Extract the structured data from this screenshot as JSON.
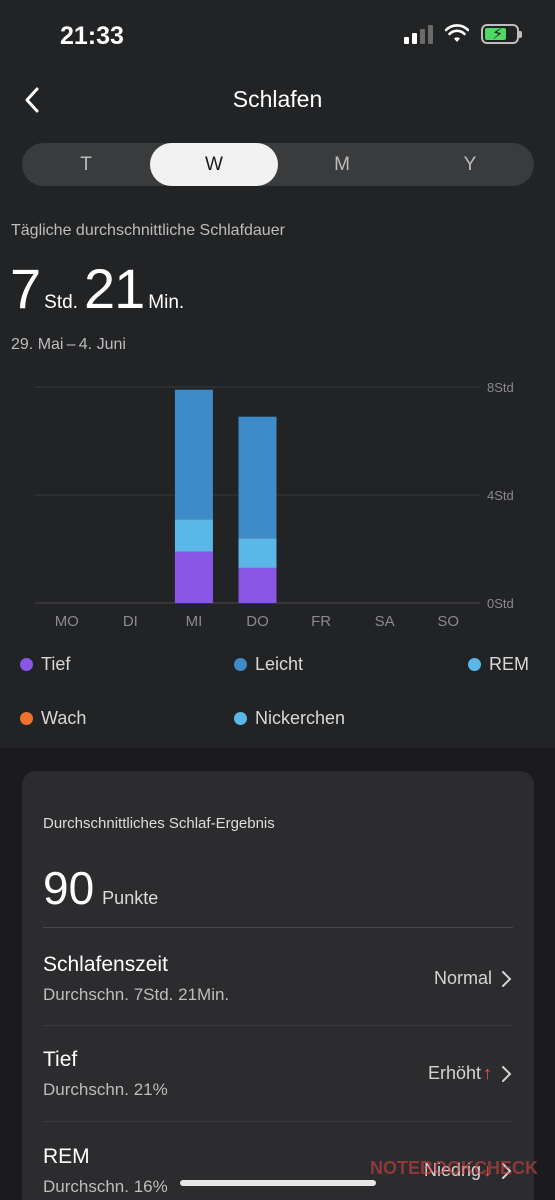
{
  "status_bar": {
    "time": "21:33"
  },
  "nav": {
    "title": "Schlafen",
    "back_icon": "chevron-left-icon"
  },
  "segments": [
    "T",
    "W",
    "M",
    "Y"
  ],
  "selected_segment": "W",
  "summary": {
    "label": "Tägliche durchschnittliche Schlafdauer",
    "hours": "7",
    "hours_unit": "Std.",
    "minutes": "21",
    "minutes_unit": "Min.",
    "date_range": "29. Mai – 4. Juni"
  },
  "chart_data": {
    "type": "bar",
    "stacked": true,
    "categories": [
      "MO",
      "DI",
      "MI",
      "DO",
      "FR",
      "SA",
      "SO"
    ],
    "y_ticks": [
      "0Std",
      "4Std",
      "8Std"
    ],
    "ylim": [
      0,
      8
    ],
    "series": [
      {
        "name": "Tief",
        "color": "#8a56e6",
        "values": [
          0,
          0,
          1.9,
          1.3,
          0,
          0,
          0
        ]
      },
      {
        "name": "REM",
        "color": "#5ab7e8",
        "values": [
          0,
          0,
          1.2,
          1.1,
          0,
          0,
          0
        ]
      },
      {
        "name": "Leicht",
        "color": "#3f8bc7",
        "values": [
          0,
          0,
          4.8,
          4.5,
          0,
          0,
          0
        ]
      }
    ]
  },
  "legend": [
    {
      "label": "Tief",
      "color": "#8a56e6"
    },
    {
      "label": "Leicht",
      "color": "#3f8bc7"
    },
    {
      "label": "REM",
      "color": "#5ab7e8"
    },
    {
      "label": "Wach",
      "color": "#f0702e"
    },
    {
      "label": "Nickerchen",
      "color": "#5ab7e8"
    }
  ],
  "score_card": {
    "title": "Durchschnittliches Schlaf-Ergebnis",
    "score": "90",
    "score_unit": "Punkte",
    "rows": [
      {
        "title": "Schlafenszeit",
        "subtitle": "Durchschn. 7Std. 21Min.",
        "status": "Normal",
        "trend": ""
      },
      {
        "title": "Tief",
        "subtitle": "Durchschn. 21%",
        "status": "Erhöht",
        "trend": "up"
      },
      {
        "title": "REM",
        "subtitle": "Durchschn. 16%",
        "status": "Niedrig",
        "trend": "down"
      }
    ]
  },
  "watermark": "NOTEBOOKCHECK"
}
